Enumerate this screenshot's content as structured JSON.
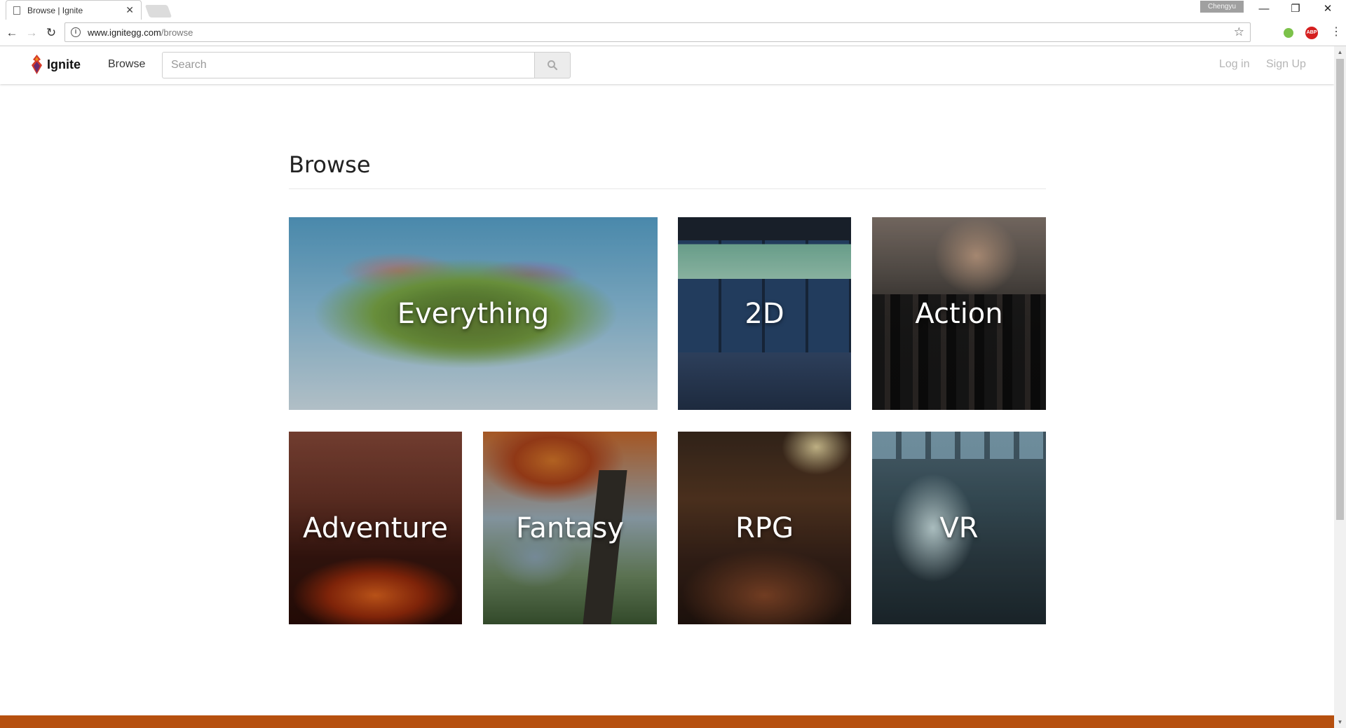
{
  "browser": {
    "tab_title": "Browse | Ignite",
    "tab_close": "✕",
    "profile_name": "Chengyu",
    "url_host": "www.ignitegg.com",
    "url_path": "/browse",
    "window_controls": {
      "minimize": "—",
      "restore": "❐",
      "close": "✕"
    }
  },
  "site": {
    "brand": "Ignite",
    "nav_browse": "Browse",
    "search_placeholder": "Search",
    "search_value": "",
    "login": "Log in",
    "signup": "Sign Up"
  },
  "page": {
    "title": "Browse"
  },
  "categories": [
    {
      "label": "Everything"
    },
    {
      "label": "2D"
    },
    {
      "label": "Action"
    },
    {
      "label": "Adventure"
    },
    {
      "label": "Fantasy"
    },
    {
      "label": "RPG"
    },
    {
      "label": "VR"
    }
  ],
  "colors": {
    "footer": "#b6500f",
    "logo_red": "#d63a28",
    "logo_orange": "#f08a1c",
    "logo_purple": "#6b2a6f"
  }
}
